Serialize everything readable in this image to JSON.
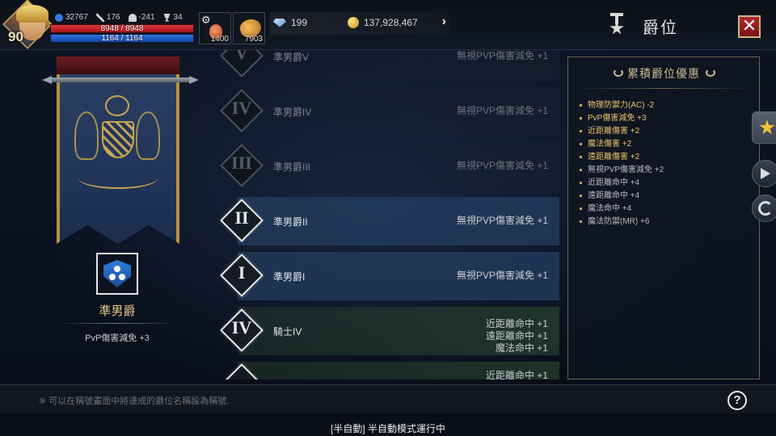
{
  "player": {
    "level": "90",
    "stats": {
      "power": "32767",
      "attack": "176",
      "defense": "-241",
      "trophy": "34"
    },
    "hp": "8948 / 8948",
    "mp": "1164 / 1164"
  },
  "slots": [
    {
      "icon": "potion-icon",
      "count": "1400"
    },
    {
      "icon": "food-icon",
      "count": "7903"
    }
  ],
  "currency": {
    "gems": "199",
    "gold": "137,928,467"
  },
  "header": {
    "title": "爵位"
  },
  "current_rank": {
    "name": "準男爵",
    "bonus": "PvP傷害減免 +3"
  },
  "ranks": [
    {
      "numeral": "V",
      "name": "準男爵V",
      "effects": [
        "無視PVP傷害減免 +1"
      ],
      "style": "dim"
    },
    {
      "numeral": "IV",
      "name": "準男爵IV",
      "effects": [
        "無視PVP傷害減免 +1"
      ],
      "style": "dim"
    },
    {
      "numeral": "III",
      "name": "準男爵III",
      "effects": [
        "無視PVP傷害減免 +1"
      ],
      "style": "dim"
    },
    {
      "numeral": "II",
      "name": "準男爵II",
      "effects": [
        "無視PVP傷害減免 +1"
      ],
      "style": "blue"
    },
    {
      "numeral": "I",
      "name": "準男爵I",
      "effects": [
        "無視PVP傷害減免 +1"
      ],
      "style": "blue"
    },
    {
      "numeral": "IV",
      "name": "騎士IV",
      "effects": [
        "近距離命中 +1",
        "遠距離命中 +1",
        "魔法命中 +1"
      ],
      "style": "green"
    },
    {
      "numeral": "",
      "name": "",
      "effects": [
        "近距離命中 +1"
      ],
      "style": "green"
    }
  ],
  "panel": {
    "title": "累積爵位優惠",
    "perks": [
      {
        "text": "物理防禦力(AC) -2",
        "highlight": true
      },
      {
        "text": "PvP傷害減免 +3",
        "highlight": true
      },
      {
        "text": "近距離傷害 +2",
        "highlight": true
      },
      {
        "text": "魔法傷害 +2",
        "highlight": true
      },
      {
        "text": "遠距離傷害 +2",
        "highlight": true
      },
      {
        "text": "無視PVP傷害減免 +2",
        "highlight": false
      },
      {
        "text": "近距離命中 +4",
        "highlight": false
      },
      {
        "text": "遠距離命中 +4",
        "highlight": false
      },
      {
        "text": "魔法命中 +4",
        "highlight": false
      },
      {
        "text": "魔法防禦(MR) +6",
        "highlight": false
      }
    ]
  },
  "footer": {
    "note": "※ 可以在稱號畫面中將達成的爵位名稱設為稱號.",
    "help": "?",
    "status": "[半自動] 半自動模式運行中"
  }
}
